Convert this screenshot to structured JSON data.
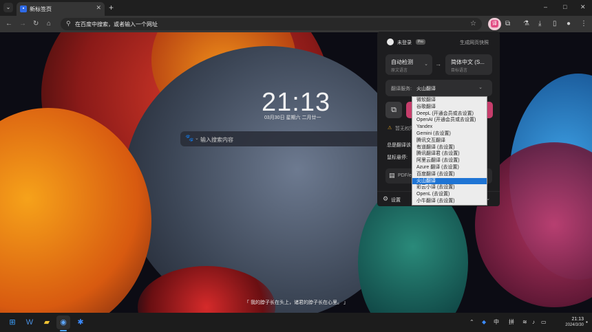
{
  "browser": {
    "tab": {
      "title": "新标签页",
      "favicon": "new-tab-page-icon"
    },
    "new_tab_symbol": "+",
    "window_controls": {
      "minimize": "–",
      "maximize": "□",
      "close": "✕"
    },
    "omnibox": {
      "placeholder": "在百度中搜索，或者输入一个网址"
    },
    "extension_icon_glyph": "译"
  },
  "new_tab_page": {
    "time": "21:13",
    "date": "03月30日 星期六 二月廿一",
    "search_placeholder": "输入搜索内容",
    "quote": "「 我的脖子长在头上，诸君的脖子长在心里。 」"
  },
  "popup": {
    "user": "未登录",
    "badge": "Pro",
    "snapshot_label": "生成网页快照",
    "source_lang": {
      "main": "自动检测",
      "sub": "原文语言"
    },
    "target_lang": {
      "main": "简体中文 (S...",
      "sub": "目标语言"
    },
    "service_label": "翻译服务:",
    "service_value": "火山翻译",
    "warn_text": "暂无权限",
    "row_always": "总是翻译该",
    "row_hover": "鼠标悬停:",
    "pdf_text": "PDF/eP",
    "settings_label": "设置"
  },
  "dropdown": {
    "selected_index": 12,
    "options": [
      "微软翻译",
      "谷歌翻译",
      "DeepL (开通会员或去设置)",
      "OpenAI (开通会员或去设置)",
      "Yandex",
      "Gemini (去设置)",
      "腾讯交互翻译",
      "有道翻译 (去设置)",
      "腾讯翻译君 (去设置)",
      "阿里云翻译 (去设置)",
      "Azure 翻译 (去设置)",
      "百度翻译 (去设置)",
      "火山翻译",
      "彩云小译 (去设置)",
      "OpenL (去设置)",
      "小牛翻译 (去设置)"
    ]
  },
  "taskbar": {
    "ime_lang": "中",
    "ime_mode": "拼",
    "time": "21:13",
    "date": "2024/3/30"
  }
}
